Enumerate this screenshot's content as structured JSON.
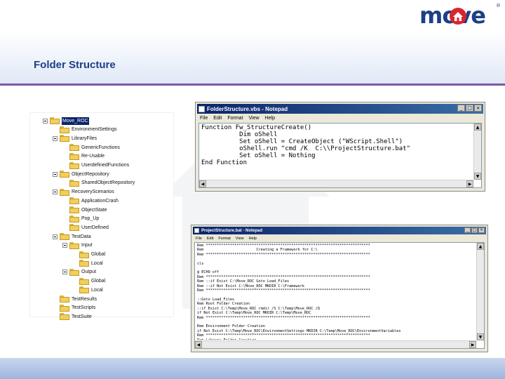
{
  "brand": {
    "logo_text": "move",
    "registered": "®"
  },
  "slide": {
    "title": "Folder Structure"
  },
  "tree": {
    "items": [
      {
        "label": "Move_ROC",
        "level": 0,
        "toggle": true,
        "selected": true
      },
      {
        "label": "EnvironmentSettings",
        "level": 1,
        "toggle": false
      },
      {
        "label": "LibraryFiles",
        "level": 1,
        "toggle": true
      },
      {
        "label": "GenericFunctions",
        "level": 2,
        "toggle": false
      },
      {
        "label": "Re-Usable",
        "level": 2,
        "toggle": false
      },
      {
        "label": "UserdefinedFunctions",
        "level": 2,
        "toggle": false
      },
      {
        "label": "ObjectRepository",
        "level": 1,
        "toggle": true
      },
      {
        "label": "SharedObjectRepository",
        "level": 2,
        "toggle": false
      },
      {
        "label": "RecoveryScenarios",
        "level": 1,
        "toggle": true
      },
      {
        "label": "ApplicationCrash",
        "level": 2,
        "toggle": false
      },
      {
        "label": "ObjectState",
        "level": 2,
        "toggle": false
      },
      {
        "label": "Pop_Up",
        "level": 2,
        "toggle": false
      },
      {
        "label": "UserDefined",
        "level": 2,
        "toggle": false
      },
      {
        "label": "TestData",
        "level": 1,
        "toggle": true
      },
      {
        "label": "Input",
        "level": 2,
        "toggle": true
      },
      {
        "label": "Global",
        "level": 3,
        "toggle": false
      },
      {
        "label": "Local",
        "level": 3,
        "toggle": false
      },
      {
        "label": "Output",
        "level": 2,
        "toggle": true
      },
      {
        "label": "Global",
        "level": 3,
        "toggle": false
      },
      {
        "label": "Local",
        "level": 3,
        "toggle": false
      },
      {
        "label": "TestResults",
        "level": 1,
        "toggle": false
      },
      {
        "label": "TestScripts",
        "level": 1,
        "toggle": false
      },
      {
        "label": "TestSuite",
        "level": 1,
        "toggle": false
      }
    ]
  },
  "notepad1": {
    "title": "FolderStructure.vbs - Notepad",
    "menu": [
      "File",
      "Edit",
      "Format",
      "View",
      "Help"
    ],
    "buttons": {
      "minimize": "_",
      "maximize": "□",
      "close": "×"
    },
    "lines": [
      "Function Fw_StructureCreate()",
      "          Dim oShell",
      "          Set oShell = CreateObject (\"WScript.Shell\")",
      "          oShell.run \"cmd /K  C:\\\\ProjectStructure.bat\"",
      "          Set oShell = Nothing",
      "End Function"
    ]
  },
  "notepad2": {
    "title": "ProjectStructure.bat - Notepad",
    "menu": [
      "File",
      "Edit",
      "Format",
      "View",
      "Help"
    ],
    "buttons": {
      "minimize": "_",
      "maximize": "□",
      "close": "×"
    },
    "lines": [
      "Rem ***************************************************************************",
      "Rem                        Creating a Framework for C:\\",
      "Rem ***************************************************************************",
      "",
      "cls",
      "",
      "@ ECHO off",
      "Rem ***************************************************************************",
      "Rem ::if Exist C:\\Move_ROC Goto Load_Files",
      "Rem ::if Not Exist C:\\Move_ROC MKDIR C:\\Framework",
      "Rem ***************************************************************************",
      "",
      "::Goto Load_Files",
      "Rem Root Folder Creation",
      "::if Exist C:\\Temp\\Move_ROC rmdir /S C:\\Temp\\Move_ROC /Q",
      "if Not Exist C:\\Temp\\Move_ROC MKDIR C:\\Temp\\Move_ROC",
      "Rem ***************************************************************************",
      "",
      "Rem Environment Folder Creation",
      "if Not Exist C:\\Temp\\Move_ROC\\EnvironmentSettings MKDIR C:\\Temp\\Move_ROC\\EnvironmentVariables",
      "Rem ***************************************************************************",
      "Rem Library Folder Creation"
    ]
  }
}
